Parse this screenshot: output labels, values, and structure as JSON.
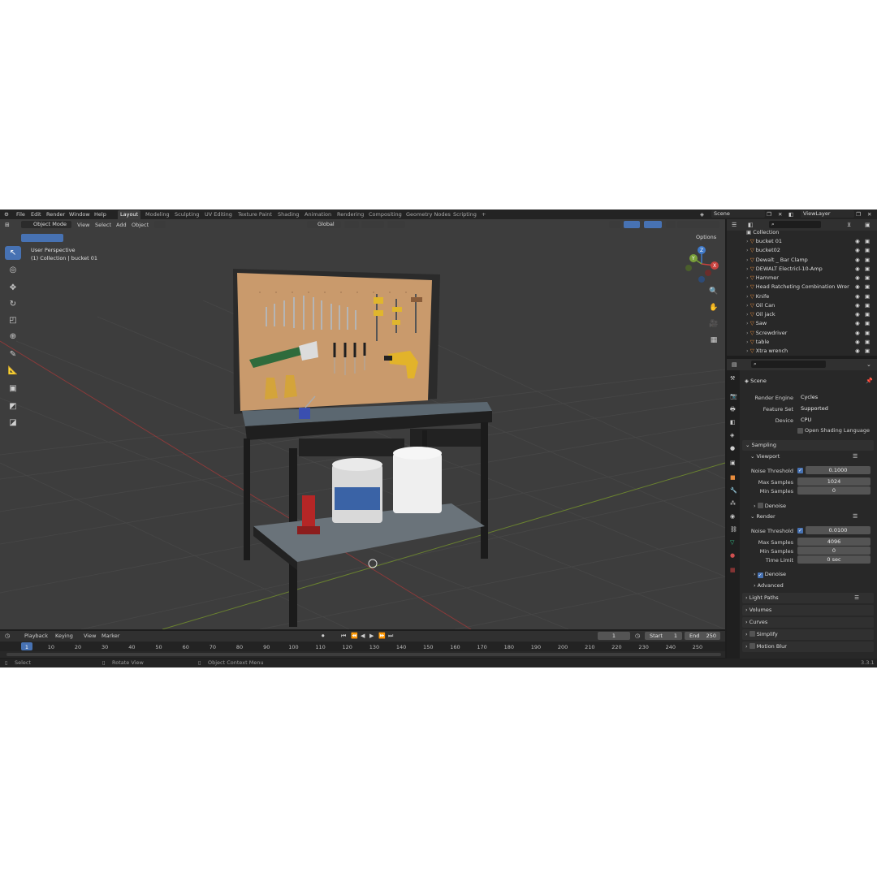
{
  "menu": [
    "File",
    "Edit",
    "Render",
    "Window",
    "Help"
  ],
  "workspaces": [
    {
      "label": "Layout",
      "active": true
    },
    {
      "label": "Modeling"
    },
    {
      "label": "Sculpting"
    },
    {
      "label": "UV Editing"
    },
    {
      "label": "Texture Paint"
    },
    {
      "label": "Shading"
    },
    {
      "label": "Animation"
    },
    {
      "label": "Rendering"
    },
    {
      "label": "Compositing"
    },
    {
      "label": "Geometry Nodes"
    },
    {
      "label": "Scripting"
    }
  ],
  "scene_name": "Scene",
  "view_layer": "ViewLayer",
  "viewport_header": {
    "mode": "Object Mode",
    "view": "View",
    "select": "Select",
    "add": "Add",
    "object": "Object",
    "orientation": "Global",
    "options": "Options"
  },
  "viewport_info": {
    "line1": "User Perspective",
    "line2": "(1) Collection | bucket 01"
  },
  "gizmo": {
    "x": "X",
    "y": "Y",
    "z": "Z"
  },
  "outliner": {
    "collection": "Collection",
    "items": [
      "bucket 01",
      "bucket02",
      "Dewalt _ Bar Clamp",
      "DEWALT Electricl-10-Amp",
      "Hammer",
      "Head Ratcheting Combination Wrer",
      "Knife",
      "Oil Can",
      "Oil jack",
      "Saw",
      "Screwdriver",
      "table",
      "Xtra wrench"
    ]
  },
  "properties": {
    "scene_label": "Scene",
    "render_engine_label": "Render Engine",
    "render_engine": "Cycles",
    "feature_set_label": "Feature Set",
    "feature_set": "Supported",
    "device_label": "Device",
    "device": "CPU",
    "osl_label": "Open Shading Language",
    "sampling": "Sampling",
    "viewport": "Viewport",
    "noise_threshold_label": "Noise Threshold",
    "vp_noise_threshold": "0.1000",
    "max_samples_label": "Max Samples",
    "vp_max_samples": "1024",
    "min_samples_label": "Min Samples",
    "vp_min_samples": "0",
    "denoise_label": "Denoise",
    "render": "Render",
    "r_noise_threshold": "0.0100",
    "r_max_samples": "4096",
    "r_min_samples": "0",
    "time_limit_label": "Time Limit",
    "r_time_limit": "0 sec",
    "advanced": "Advanced",
    "light_paths": "Light Paths",
    "volumes": "Volumes",
    "curves": "Curves",
    "simplify": "Simplify",
    "motion_blur": "Motion Blur"
  },
  "timeline": {
    "playback": "Playback",
    "keying": "Keying",
    "view": "View",
    "marker": "Marker",
    "current_frame": "1",
    "start_label": "Start",
    "start": "1",
    "end_label": "End",
    "end": "250",
    "ticks": [
      "1",
      "10",
      "20",
      "30",
      "40",
      "50",
      "60",
      "70",
      "80",
      "90",
      "100",
      "110",
      "120",
      "130",
      "140",
      "150",
      "160",
      "170",
      "180",
      "190",
      "200",
      "210",
      "220",
      "230",
      "240",
      "250"
    ]
  },
  "statusbar": {
    "select": "Select",
    "rotate": "Rotate View",
    "context": "Object Context Menu",
    "version": "3.3.1"
  },
  "colors": {
    "accent": "#4772b3",
    "x_axis": "#c8423e",
    "y_axis": "#7aa13a",
    "z_axis": "#3f79c9",
    "mesh_icon": "#e98d3d",
    "vertex_icon": "#35c08a"
  }
}
